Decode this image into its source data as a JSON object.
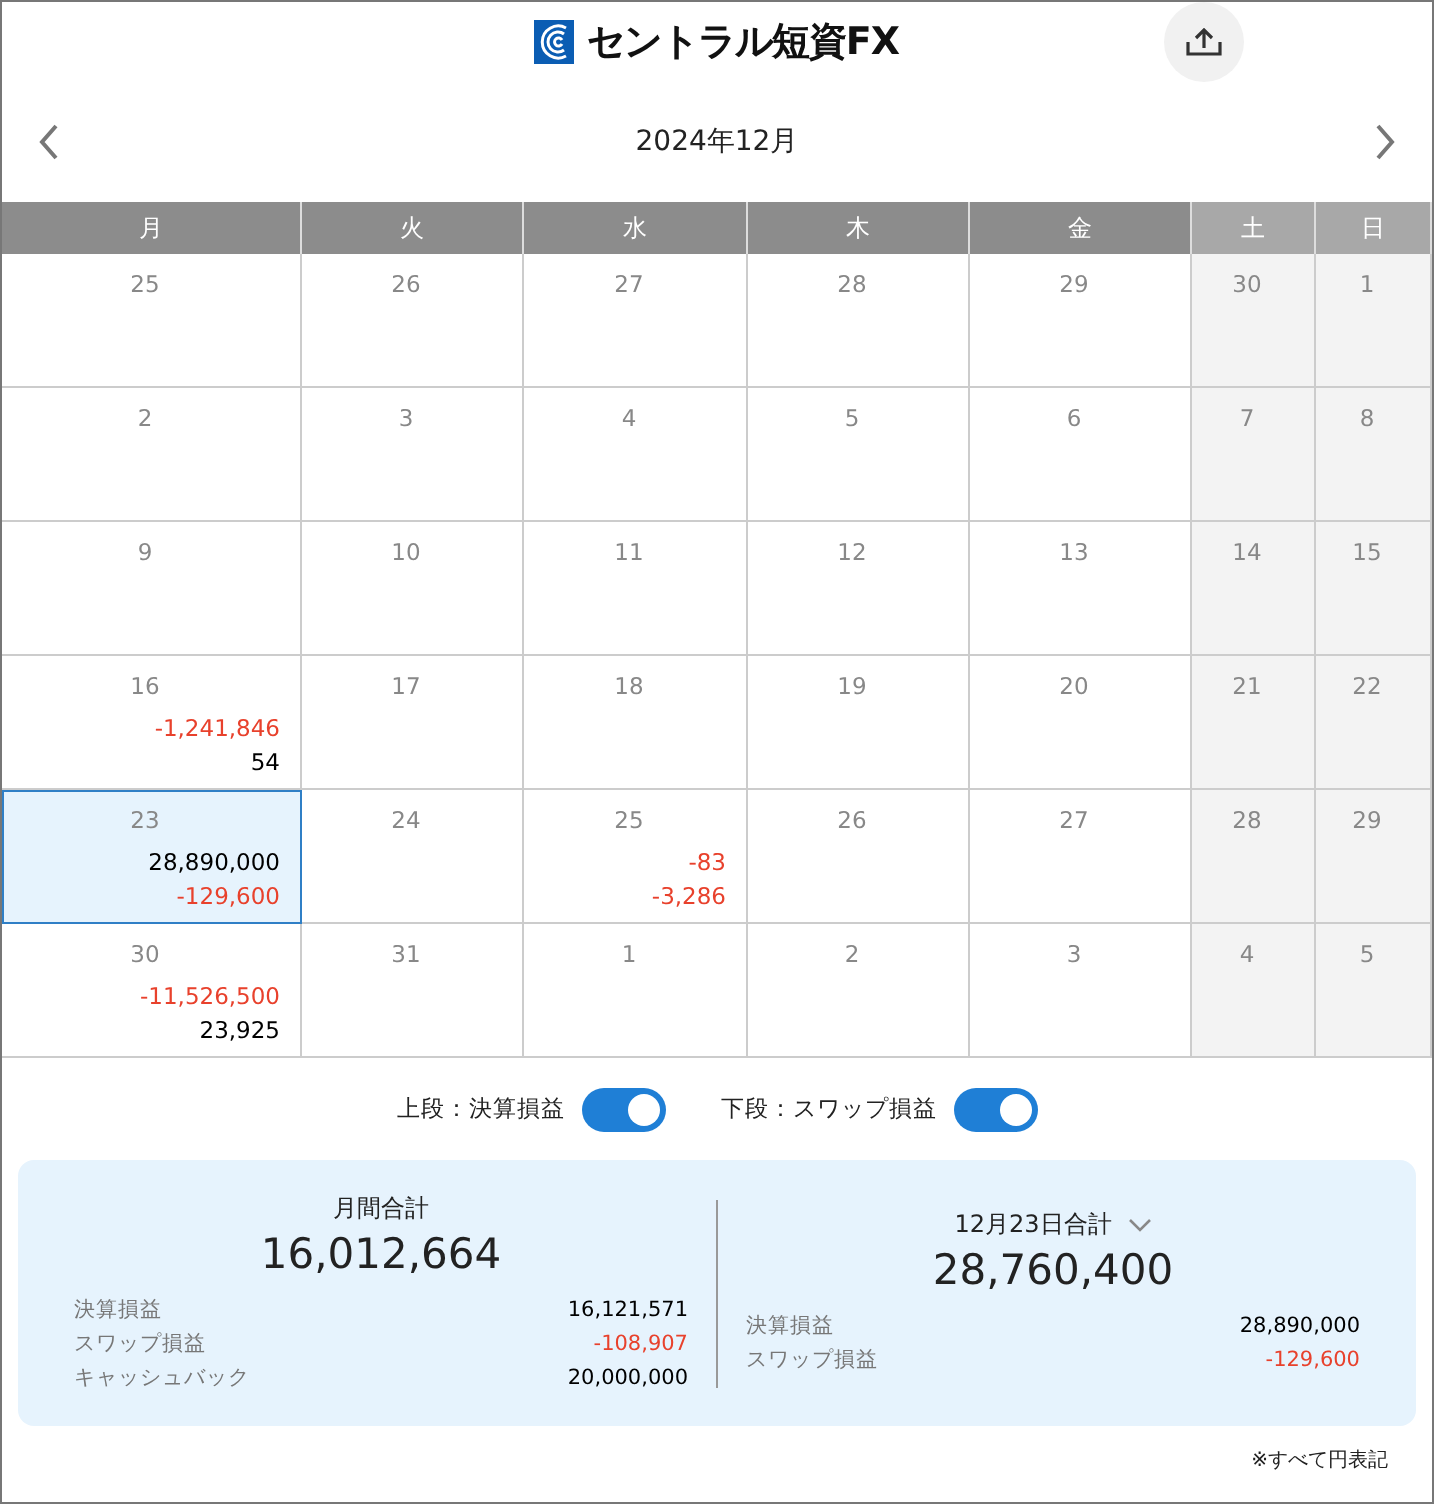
{
  "header": {
    "logo_text": "セントラル短資FX"
  },
  "month_nav": {
    "title": "2024年12月"
  },
  "weekdays": [
    {
      "label": "月",
      "weekend": false
    },
    {
      "label": "火",
      "weekend": false
    },
    {
      "label": "水",
      "weekend": false
    },
    {
      "label": "木",
      "weekend": false
    },
    {
      "label": "金",
      "weekend": false
    },
    {
      "label": "土",
      "weekend": true
    },
    {
      "label": "日",
      "weekend": true
    }
  ],
  "weeks": [
    [
      {
        "date": "25",
        "selected": false
      },
      {
        "date": "26",
        "selected": false
      },
      {
        "date": "27",
        "selected": false
      },
      {
        "date": "28",
        "selected": false
      },
      {
        "date": "29",
        "selected": false
      },
      {
        "date": "30",
        "selected": false
      },
      {
        "date": "1",
        "selected": false
      }
    ],
    [
      {
        "date": "2",
        "selected": false
      },
      {
        "date": "3",
        "selected": false
      },
      {
        "date": "4",
        "selected": false
      },
      {
        "date": "5",
        "selected": false
      },
      {
        "date": "6",
        "selected": false
      },
      {
        "date": "7",
        "selected": false
      },
      {
        "date": "8",
        "selected": false
      }
    ],
    [
      {
        "date": "9",
        "selected": false
      },
      {
        "date": "10",
        "selected": false
      },
      {
        "date": "11",
        "selected": false
      },
      {
        "date": "12",
        "selected": false
      },
      {
        "date": "13",
        "selected": false
      },
      {
        "date": "14",
        "selected": false
      },
      {
        "date": "15",
        "selected": false
      }
    ],
    [
      {
        "date": "16",
        "selected": false,
        "values": [
          {
            "text": "-1,241,846",
            "color": "#e8412c"
          },
          {
            "text": "54",
            "color": "#000000"
          }
        ]
      },
      {
        "date": "17",
        "selected": false
      },
      {
        "date": "18",
        "selected": false
      },
      {
        "date": "19",
        "selected": false
      },
      {
        "date": "20",
        "selected": false
      },
      {
        "date": "21",
        "selected": false
      },
      {
        "date": "22",
        "selected": false
      }
    ],
    [
      {
        "date": "23",
        "selected": true,
        "values": [
          {
            "text": "28,890,000",
            "color": "#000000"
          },
          {
            "text": "-129,600",
            "color": "#e8412c"
          }
        ]
      },
      {
        "date": "24",
        "selected": false
      },
      {
        "date": "25",
        "selected": false,
        "values": [
          {
            "text": "-83",
            "color": "#e8412c"
          },
          {
            "text": "-3,286",
            "color": "#e8412c"
          }
        ]
      },
      {
        "date": "26",
        "selected": false
      },
      {
        "date": "27",
        "selected": false
      },
      {
        "date": "28",
        "selected": false
      },
      {
        "date": "29",
        "selected": false
      }
    ],
    [
      {
        "date": "30",
        "selected": false,
        "values": [
          {
            "text": "-11,526,500",
            "color": "#e8412c"
          },
          {
            "text": "23,925",
            "color": "#000000"
          }
        ]
      },
      {
        "date": "31",
        "selected": false
      },
      {
        "date": "1",
        "selected": false
      },
      {
        "date": "2",
        "selected": false
      },
      {
        "date": "3",
        "selected": false
      },
      {
        "date": "4",
        "selected": false
      },
      {
        "date": "5",
        "selected": false
      }
    ]
  ],
  "toggles": [
    {
      "label": "上段：決算損益",
      "on": true
    },
    {
      "label": "下段：スワップ損益",
      "on": true
    }
  ],
  "summary": [
    {
      "title": "月間合計",
      "dropdown": false,
      "total": "16,012,664",
      "rows": [
        {
          "label": "決算損益",
          "value": "16,121,571",
          "color": "#000000"
        },
        {
          "label": "スワップ損益",
          "value": "-108,907",
          "color": "#e8412c"
        },
        {
          "label": "キャッシュバック",
          "value": "20,000,000",
          "color": "#000000"
        }
      ]
    },
    {
      "title": "12月23日合計",
      "dropdown": true,
      "total": "28,760,400",
      "rows": [
        {
          "label": "決算損益",
          "value": "28,890,000",
          "color": "#000000"
        },
        {
          "label": "スワップ損益",
          "value": "-129,600",
          "color": "#e8412c"
        }
      ]
    }
  ],
  "footnote": "※すべて円表記"
}
